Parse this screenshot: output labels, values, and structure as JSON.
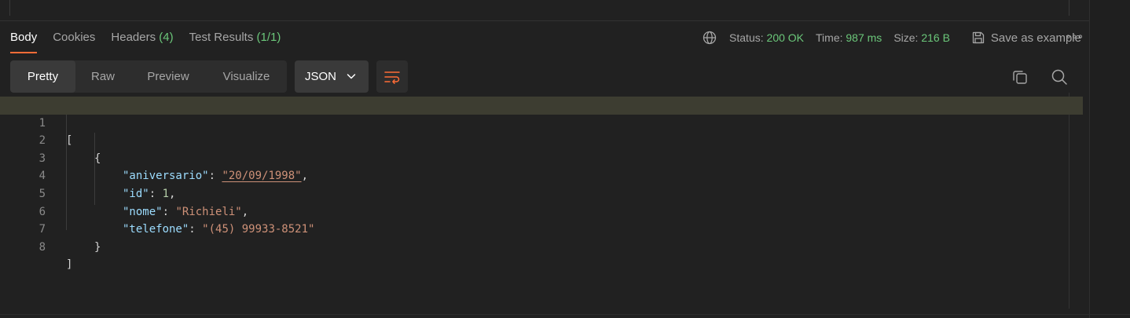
{
  "tabs": [
    {
      "label": "Body",
      "count": ""
    },
    {
      "label": "Cookies",
      "count": ""
    },
    {
      "label": "Headers",
      "count": "(4)"
    },
    {
      "label": "Test Results",
      "count": "(1/1)"
    }
  ],
  "status": {
    "status_label": "Status:",
    "status_value": "200 OK",
    "time_label": "Time:",
    "time_value": "987 ms",
    "size_label": "Size:",
    "size_value": "216 B",
    "save_label": "Save as example",
    "more_label": "∘∘∘"
  },
  "views": [
    "Pretty",
    "Raw",
    "Preview",
    "Visualize"
  ],
  "format": {
    "selected": "JSON"
  },
  "colors": {
    "accent": "#ff6c37",
    "success": "#6bc77a",
    "key": "#9cdcfe",
    "string": "#ce9178",
    "number": "#b5cea8"
  },
  "code": {
    "line_numbers": [
      "1",
      "2",
      "3",
      "4",
      "5",
      "6",
      "7",
      "8"
    ],
    "open_array": "[",
    "open_object": "{",
    "close_object": "}",
    "close_array": "]",
    "fields": [
      {
        "key": "\"aniversario\"",
        "value": "\"20/09/1998\"",
        "type": "string",
        "comma": ","
      },
      {
        "key": "\"id\"",
        "value": "1",
        "type": "number",
        "comma": ","
      },
      {
        "key": "\"nome\"",
        "value": "\"Richieli\"",
        "type": "string",
        "comma": ","
      },
      {
        "key": "\"telefone\"",
        "value": "\"(45) 99933-8521\"",
        "type": "string",
        "comma": ""
      }
    ]
  },
  "icons": [
    "globe-icon",
    "save-icon",
    "more-icon",
    "chevron-down-icon",
    "wrap-lines-icon",
    "copy-icon",
    "search-icon"
  ]
}
